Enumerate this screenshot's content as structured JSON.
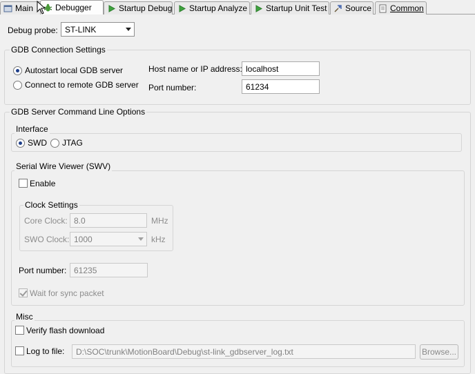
{
  "tabs": [
    {
      "label": "Main",
      "icon": "main-tab-icon"
    },
    {
      "label": "Debugger",
      "icon": "debugger-tab-icon",
      "active": true
    },
    {
      "label": "Startup Debug",
      "icon": "run-green-icon"
    },
    {
      "label": "Startup Analyze",
      "icon": "run-green-icon"
    },
    {
      "label": "Startup Unit Test",
      "icon": "run-green-icon"
    },
    {
      "label": "Source",
      "icon": "source-icon"
    },
    {
      "label": "Common",
      "icon": "common-icon"
    }
  ],
  "debug_probe": {
    "label": "Debug probe:",
    "value": "ST-LINK"
  },
  "gdb_connection": {
    "title": "GDB Connection Settings",
    "autostart_label": "Autostart local GDB server",
    "autostart_selected": true,
    "remote_label": "Connect to remote GDB server",
    "host_label": "Host name or IP address:",
    "host_value": "localhost",
    "port_label": "Port number:",
    "port_value": "61234"
  },
  "gdb_server_options": {
    "title": "GDB Server Command Line Options",
    "interface": {
      "title": "Interface",
      "swd_label": "SWD",
      "swd_selected": true,
      "jtag_label": "JTAG"
    },
    "swv": {
      "title": "Serial Wire Viewer (SWV)",
      "enable_label": "Enable",
      "enable_checked": false,
      "clock_settings": {
        "title": "Clock Settings",
        "core_clock_label": "Core Clock:",
        "core_clock_value": "8.0",
        "core_clock_unit": "MHz",
        "swo_clock_label": "SWO Clock:",
        "swo_clock_value": "1000",
        "swo_clock_unit": "kHz"
      },
      "port_label": "Port number:",
      "port_value": "61235",
      "wait_sync_label": "Wait for sync packet",
      "wait_sync_checked": true
    },
    "misc": {
      "title": "Misc",
      "verify_flash_label": "Verify flash download",
      "verify_flash_checked": false,
      "log_to_file_label": "Log to file:",
      "log_to_file_checked": false,
      "log_file_path": "D:\\SOC\\trunk\\MotionBoard\\Debug\\st-link_gdbserver_log.txt",
      "browse_label": "Browse..."
    }
  }
}
